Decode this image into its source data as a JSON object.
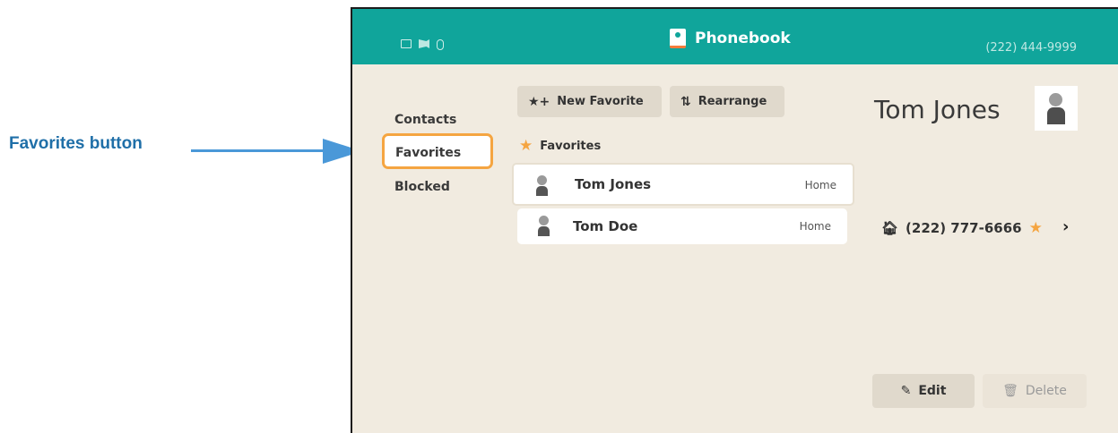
{
  "callout": {
    "label": "Favorites button"
  },
  "header": {
    "title": "Phonebook",
    "phone_number": "(222) 444-9999"
  },
  "sidebar": {
    "items": [
      {
        "label": "Contacts"
      },
      {
        "label": "Favorites"
      },
      {
        "label": "Blocked"
      }
    ]
  },
  "toolbar": {
    "new_favorite": "New Favorite",
    "rearrange": "Rearrange"
  },
  "favorites": {
    "header": "Favorites",
    "rows": [
      {
        "name": "Tom Jones",
        "type": "Home"
      },
      {
        "name": "Tom Doe",
        "type": "Home"
      }
    ]
  },
  "detail": {
    "name": "Tom Jones",
    "phone": "(222) 777-6666",
    "edit_label": "Edit",
    "delete_label": "Delete"
  },
  "colors": {
    "accent": "#10a59b",
    "highlight": "#f5a541",
    "callout": "#4a98d8"
  }
}
